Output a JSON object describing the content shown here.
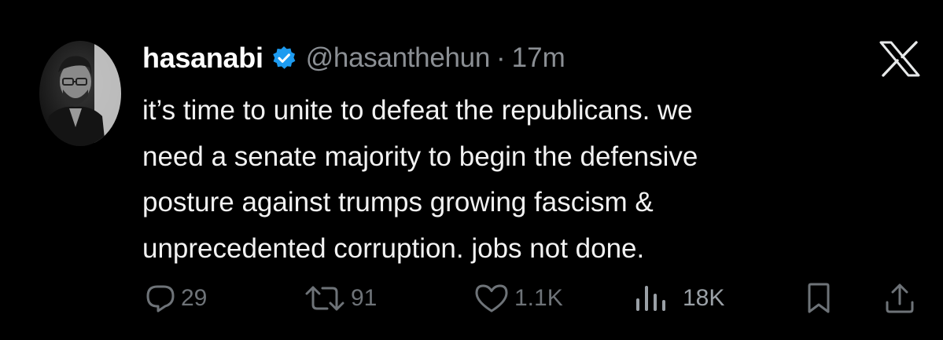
{
  "author": {
    "display_name": "hasanabi",
    "handle": "@hasanthehun",
    "separator": "·",
    "time": "17m",
    "verified": true
  },
  "tweet": {
    "lines": [
      "it’s time to unite to defeat the republicans. we",
      "need a senate majority to begin the defensive",
      "posture against trumps growing fascism &",
      "unprecedented corruption. jobs not done."
    ]
  },
  "actions": {
    "replies": "29",
    "retweets": "91",
    "likes": "1.1K",
    "views": "18K"
  },
  "colors": {
    "background": "#000000",
    "text": "#e7e9ea",
    "muted": "#71767b",
    "verified": "#1d9bf0"
  },
  "icons": [
    "reply-icon",
    "retweet-icon",
    "like-icon",
    "views-icon",
    "bookmark-icon",
    "share-icon",
    "x-logo-icon",
    "verified-badge-icon"
  ]
}
